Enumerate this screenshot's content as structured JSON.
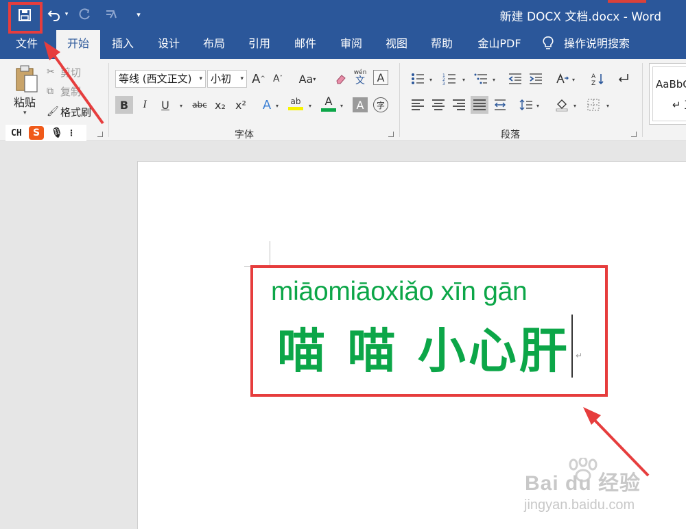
{
  "window": {
    "title": "新建 DOCX 文档.docx  -  Word"
  },
  "quick_access": {
    "save_icon": "save-icon",
    "undo_icon": "undo-icon",
    "redo_icon": "redo-icon",
    "repeat_icon": "repeat-icon",
    "customize_glyph": "▾"
  },
  "tabs": [
    {
      "label": "文件"
    },
    {
      "label": "开始"
    },
    {
      "label": "插入"
    },
    {
      "label": "设计"
    },
    {
      "label": "布局"
    },
    {
      "label": "引用"
    },
    {
      "label": "邮件"
    },
    {
      "label": "审阅"
    },
    {
      "label": "视图"
    },
    {
      "label": "帮助"
    },
    {
      "label": "金山PDF"
    }
  ],
  "tell_me": {
    "label": "操作说明搜索"
  },
  "clipboard": {
    "paste_label": "粘贴",
    "cut_label": "剪切",
    "copy_label": "复制",
    "format_painter_label": "格式刷"
  },
  "ime": {
    "mode": "CH",
    "logo": "S"
  },
  "font": {
    "group_label": "字体",
    "font_name": "等线 (西文正文)",
    "font_size": "小初",
    "grow_label": "A",
    "shrink_label": "A",
    "case_label": "Aa",
    "phonetic_top": "wén",
    "phonetic_bottom": "文",
    "border_label": "A",
    "bold": "B",
    "italic": "I",
    "underline": "U",
    "strike": "abc",
    "subscript": "x₂",
    "superscript": "x²",
    "effects": "A",
    "highlight": "ab",
    "font_color": "A",
    "shading": "A",
    "enclose": "字"
  },
  "paragraph": {
    "group_label": "段落"
  },
  "styles": {
    "preview": "AaBbC",
    "name": "↵ 正"
  },
  "document": {
    "pinyin": "miāomiāoxiǎo xīn gān",
    "text": "喵 喵 小心肝",
    "paragraph_mark": "↵"
  },
  "watermark": {
    "brand": "Bai  du 经验",
    "url": "jingyan.baidu.com"
  },
  "colors": {
    "word_blue": "#2b579a",
    "text_green": "#0ca648",
    "annotation_red": "#e63d3d"
  }
}
